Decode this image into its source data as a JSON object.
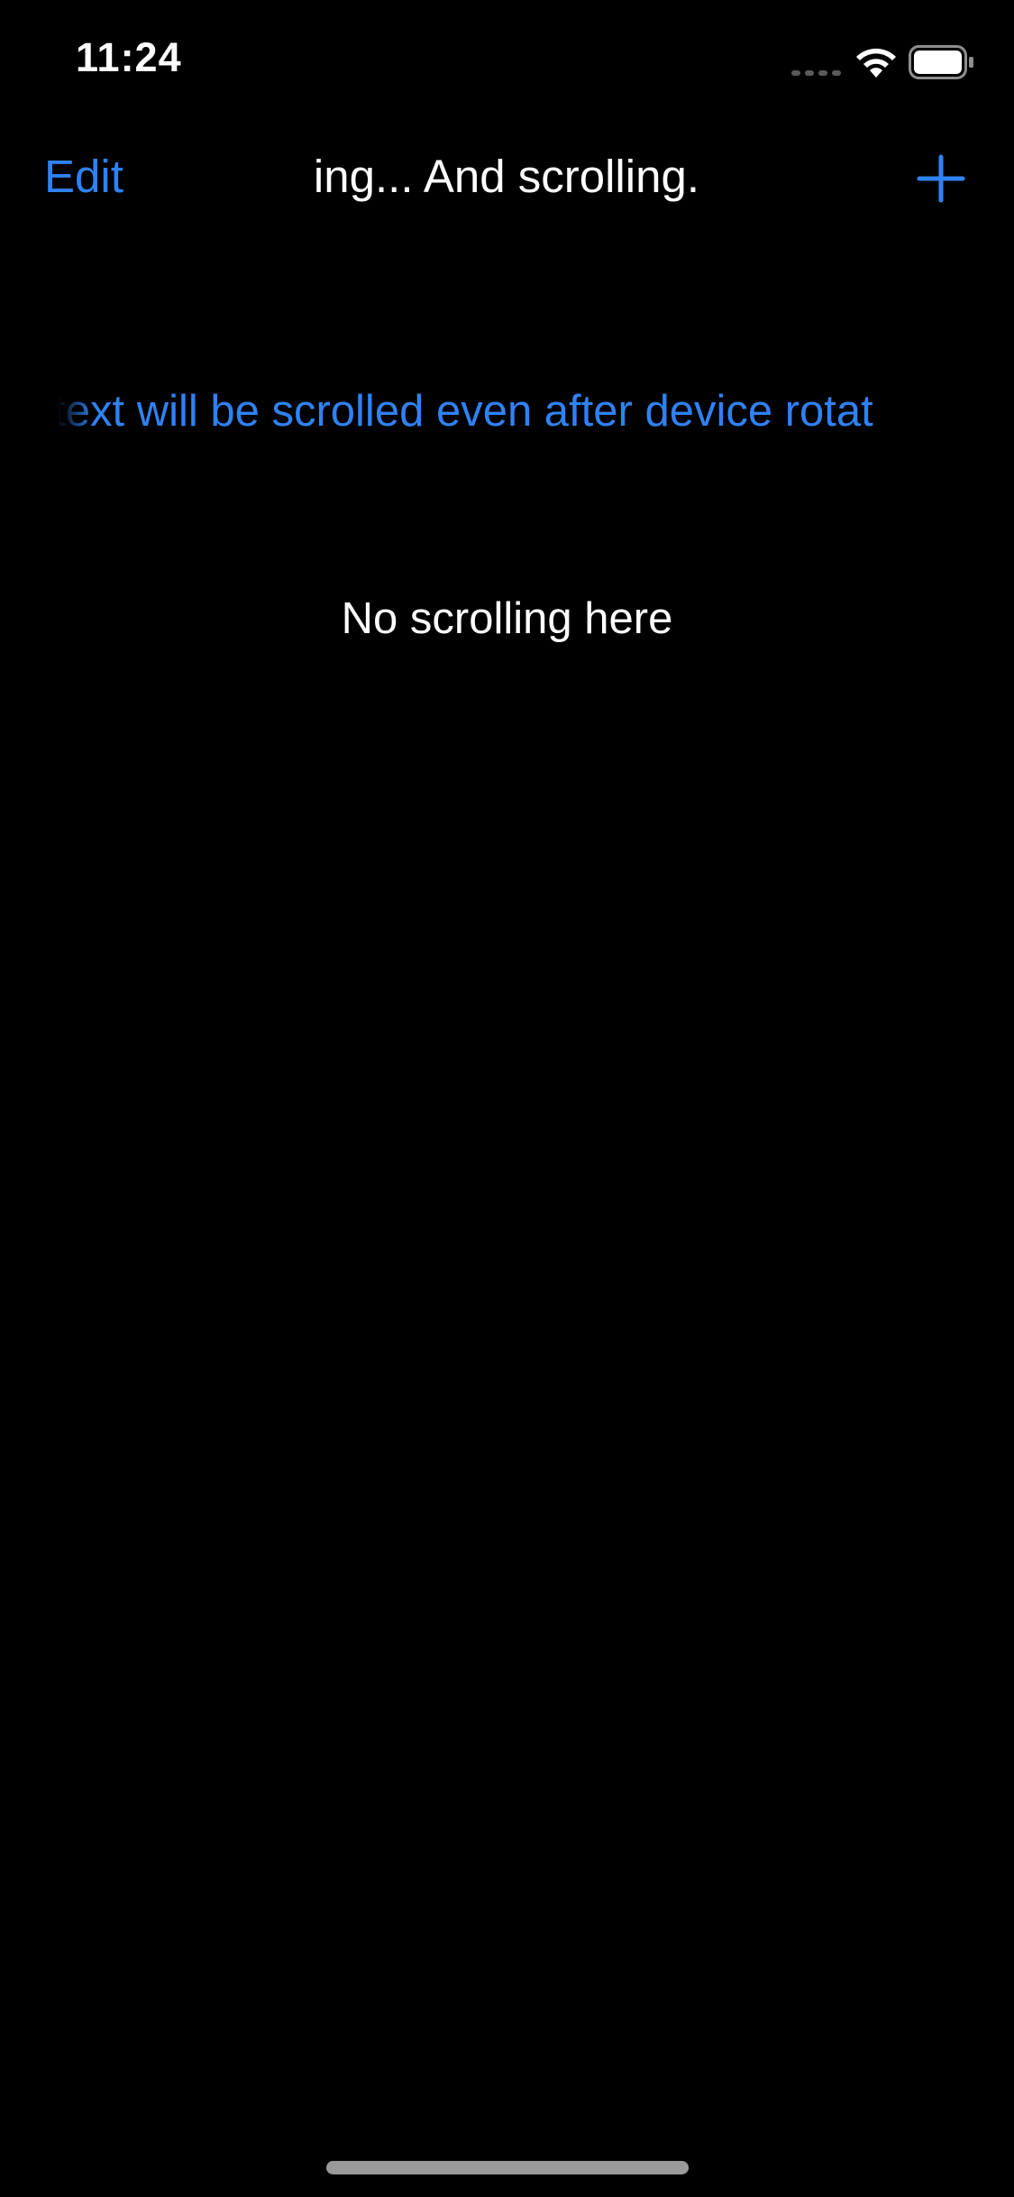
{
  "status_bar": {
    "time": "11:24",
    "signal_icon": "cellular-signal-dots",
    "wifi_icon": "wifi",
    "battery_icon": "battery-full"
  },
  "nav_bar": {
    "edit_label": "Edit",
    "title": "ing... And scrolling.",
    "add_icon": "plus"
  },
  "content": {
    "marquee_text": "s text will be scrolled even after device rotat",
    "static_text": "No scrolling here"
  },
  "colors": {
    "background": "#000000",
    "accent": "#2f82f4",
    "text": "#ffffff"
  }
}
